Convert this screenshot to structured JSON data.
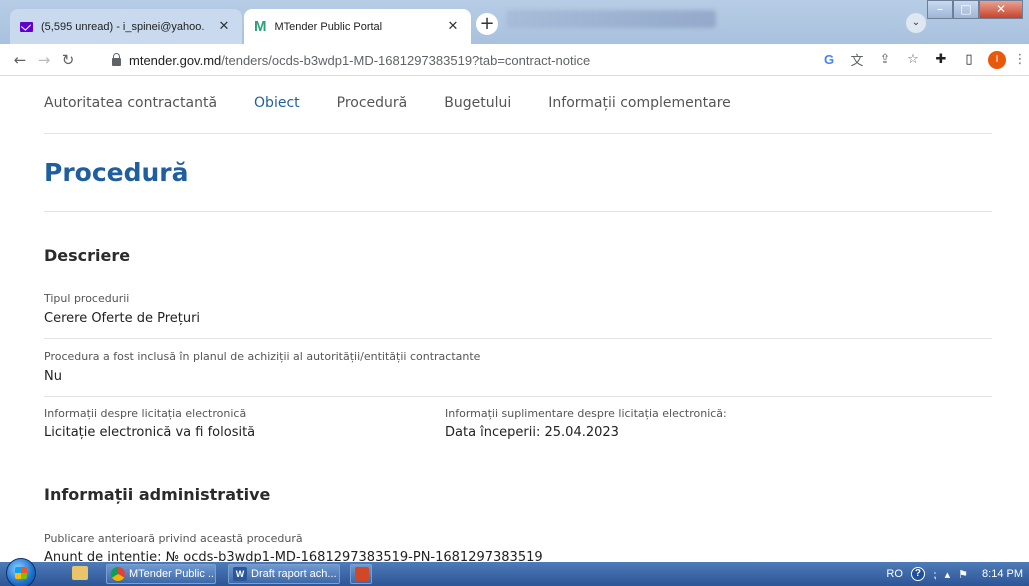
{
  "browser": {
    "tabs": [
      {
        "title": "(5,595 unread) - i_spinei@yahoo.",
        "icon": "mail-icon",
        "active": false
      },
      {
        "title": "MTender Public Portal",
        "icon": "mtender-icon",
        "active": true
      }
    ],
    "address": {
      "host": "mtender.gov.md",
      "path": "/tenders/ocds-b3wdp1-MD-1681297383519?tab=contract-notice"
    }
  },
  "subnav": {
    "items": [
      "Autoritatea contractantă",
      "Obiect",
      "Procedură",
      "Bugetului",
      "Informații complementare"
    ],
    "active": "Obiect"
  },
  "page": {
    "title": "Procedură",
    "descriere": {
      "heading": "Descriere",
      "procedure_type_label": "Tipul procedurii",
      "procedure_type_value": "Cerere Oferte de Prețuri",
      "in_plan_label": "Procedura a fost inclusă în planul de achiziții al autorității/entității contractante",
      "in_plan_value": "Nu",
      "eauction_label": "Informații despre licitația electronică",
      "eauction_value": "Licitație electronică va fi folosită",
      "eauction_extra_label": "Informații suplimentare despre licitația electronică:",
      "eauction_extra_value": "Data începerii: 25.04.2023"
    },
    "administrative": {
      "heading": "Informații administrative",
      "prior_publication_label": "Publicare anterioară privind această procedură",
      "prior_publication_value": "Anunt de intentie: № ocds-b3wdp1-MD-1681297383519-PN-1681297383519"
    }
  },
  "taskbar": {
    "tasks": [
      "MTender Public ...",
      "Draft raport ach..."
    ],
    "language": "RO",
    "time": "8:14 PM"
  }
}
